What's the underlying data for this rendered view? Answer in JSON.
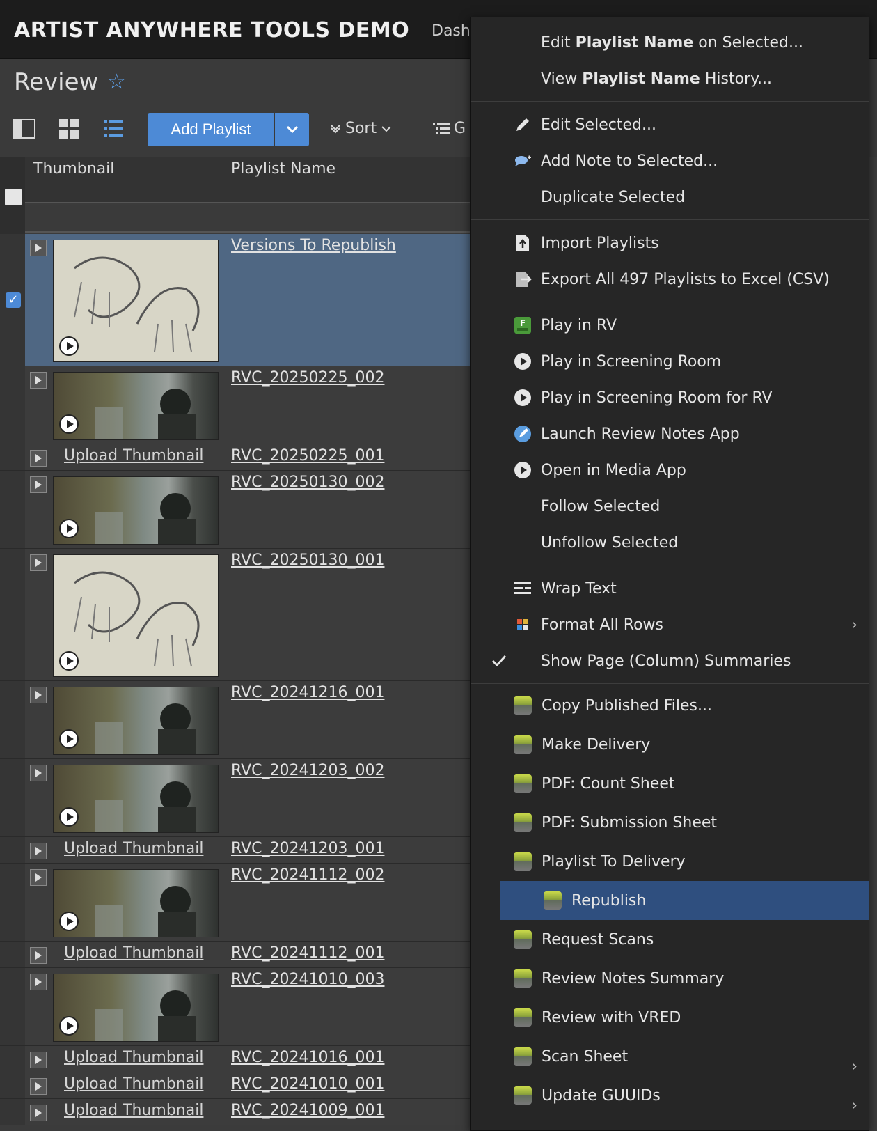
{
  "header": {
    "app_title": "ARTIST ANYWHERE TOOLS DEMO",
    "nav_partial": "Dash"
  },
  "page": {
    "title": "Review",
    "star": "☆"
  },
  "toolbar": {
    "add_playlist": "Add Playlist",
    "sort": "Sort",
    "group_partial": "G"
  },
  "grid": {
    "columns": {
      "thumbnail": "Thumbnail",
      "playlist_name": "Playlist Name"
    },
    "upload_label": "Upload Thumbnail",
    "rows": [
      {
        "name": "Versions To Republish",
        "thumb": "sketch",
        "selected": true
      },
      {
        "name": "RVC_20250225_002",
        "thumb": "photo"
      },
      {
        "name": "RVC_20250225_001",
        "thumb": "none"
      },
      {
        "name": "RVC_20250130_002",
        "thumb": "photo"
      },
      {
        "name": "RVC_20250130_001",
        "thumb": "sketch"
      },
      {
        "name": "RVC_20241216_001",
        "thumb": "photo"
      },
      {
        "name": "RVC_20241203_002",
        "thumb": "photo"
      },
      {
        "name": "RVC_20241203_001",
        "thumb": "none"
      },
      {
        "name": "RVC_20241112_002",
        "thumb": "photo"
      },
      {
        "name": "RVC_20241112_001",
        "thumb": "none"
      },
      {
        "name": "RVC_20241010_003",
        "thumb": "photo"
      },
      {
        "name": "RVC_20241016_001",
        "thumb": "none"
      },
      {
        "name": "RVC_20241010_001",
        "thumb": "none"
      },
      {
        "name": "RVC_20241009_001",
        "thumb": "none"
      }
    ]
  },
  "context_menu": {
    "edit_playlist_name": [
      "Edit ",
      "Playlist Name",
      " on Selected..."
    ],
    "view_playlist_history": [
      "View ",
      "Playlist Name",
      " History..."
    ],
    "edit_selected": "Edit Selected...",
    "add_note": "Add Note to Selected...",
    "duplicate": "Duplicate Selected",
    "import": "Import Playlists",
    "export": "Export All 497 Playlists to Excel (CSV)",
    "play_rv": "Play in RV",
    "play_screening": "Play in Screening Room",
    "play_screening_rv": "Play in Screening Room for RV",
    "launch_notes": "Launch Review Notes App",
    "open_media": "Open in Media App",
    "follow": "Follow Selected",
    "unfollow": "Unfollow Selected",
    "wrap_text": "Wrap Text",
    "format_rows": "Format All Rows",
    "show_summaries": "Show Page (Column) Summaries",
    "actions": [
      "Copy Published Files...",
      "Make Delivery",
      "PDF: Count Sheet",
      "PDF: Submission Sheet",
      "Playlist To Delivery",
      "Republish",
      "Request Scans",
      "Review Notes Summary",
      "Review with VRED",
      "Scan Sheet",
      "Update GUUIDs"
    ],
    "highlighted": "Republish"
  },
  "colors": {
    "accent": "#4d8ad6",
    "selected_row": "#4f6783",
    "menu_highlight": "#2f4f7f"
  }
}
